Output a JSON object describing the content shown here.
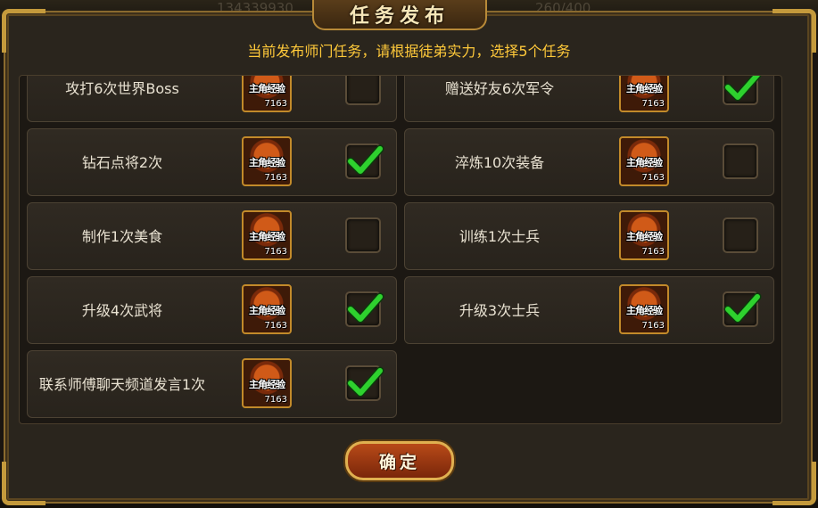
{
  "background": {
    "left_number": "134339930",
    "right_number": "260/400"
  },
  "dialog": {
    "title": "任务发布",
    "subtitle": "当前发布师门任务，请根据徒弟实力，选择5个任务",
    "confirm_label": "确定"
  },
  "tasks": [
    {
      "label": "攻打6次世界Boss",
      "reward_name": "主角经验",
      "reward_count": "7163",
      "checked": false
    },
    {
      "label": "赠送好友6次军令",
      "reward_name": "主角经验",
      "reward_count": "7163",
      "checked": true
    },
    {
      "label": "钻石点将2次",
      "reward_name": "主角经验",
      "reward_count": "7163",
      "checked": true
    },
    {
      "label": "淬炼10次装备",
      "reward_name": "主角经验",
      "reward_count": "7163",
      "checked": false
    },
    {
      "label": "制作1次美食",
      "reward_name": "主角经验",
      "reward_count": "7163",
      "checked": false
    },
    {
      "label": "训练1次士兵",
      "reward_name": "主角经验",
      "reward_count": "7163",
      "checked": false
    },
    {
      "label": "升级4次武将",
      "reward_name": "主角经验",
      "reward_count": "7163",
      "checked": true
    },
    {
      "label": "升级3次士兵",
      "reward_name": "主角经验",
      "reward_count": "7163",
      "checked": true
    },
    {
      "label": "联系师傅聊天频道发言1次",
      "reward_name": "主角经验",
      "reward_count": "7163",
      "checked": true
    }
  ],
  "colors": {
    "accent_gold": "#ffc93a",
    "check_green": "#2ed12e"
  }
}
